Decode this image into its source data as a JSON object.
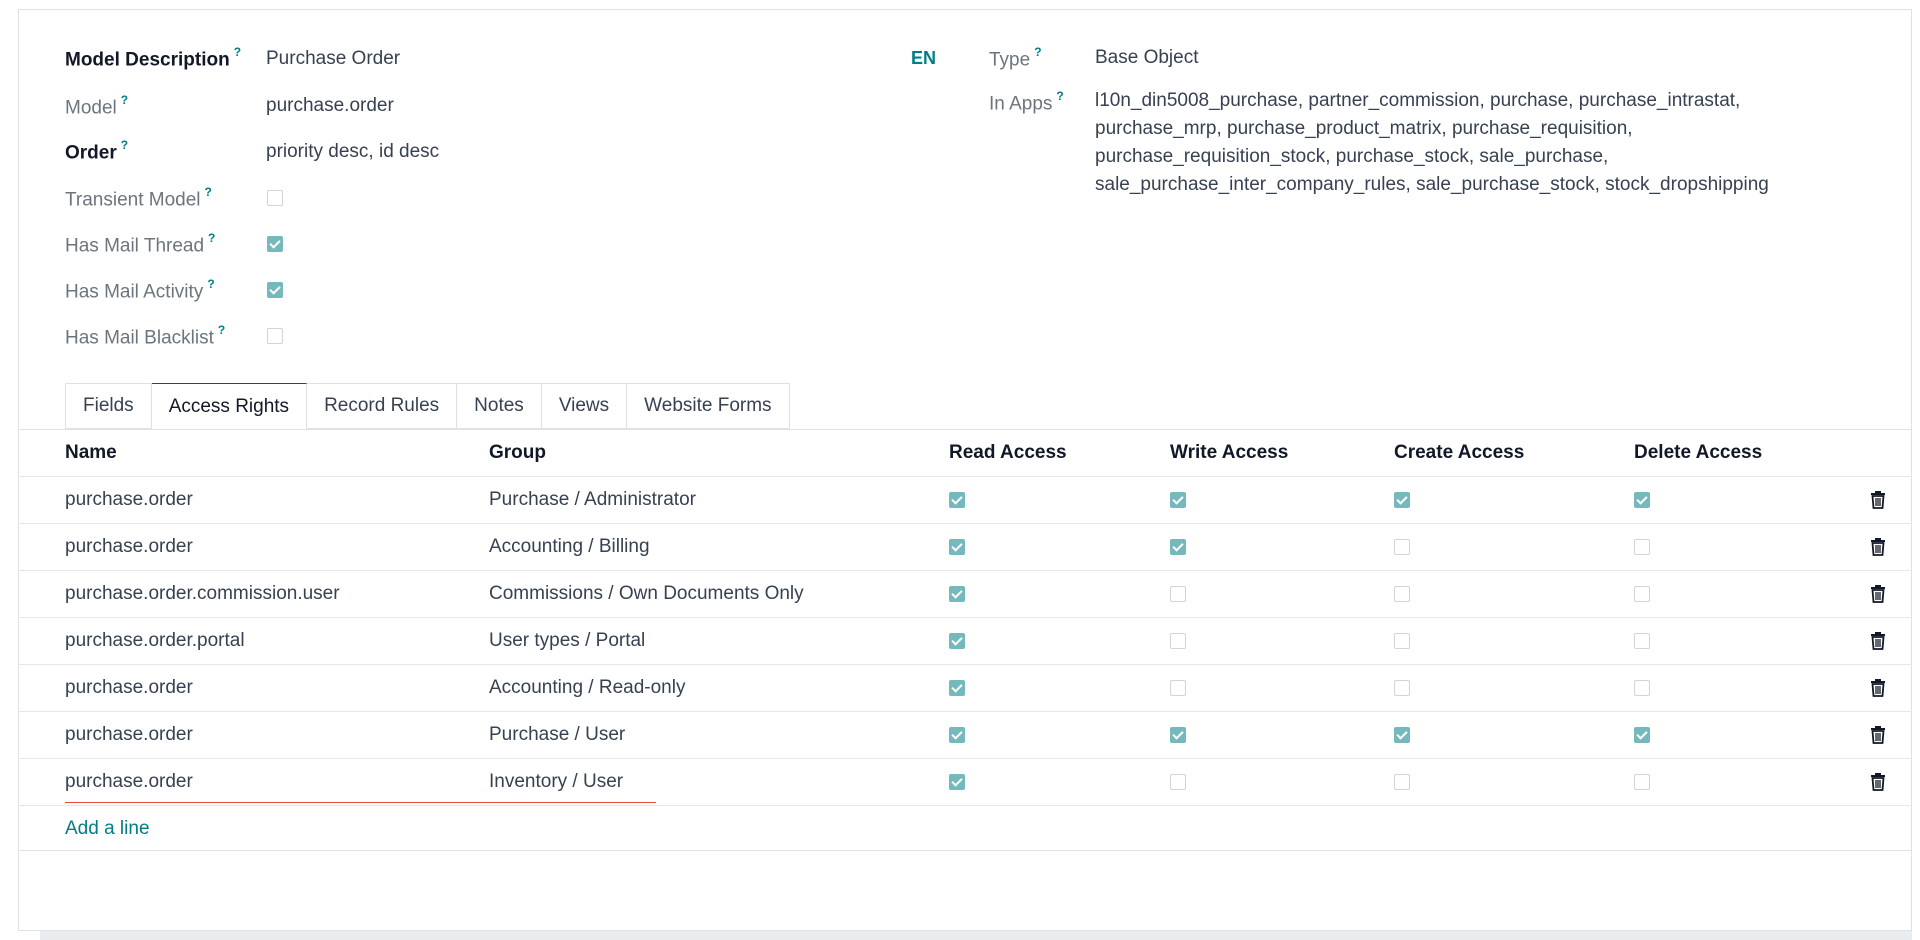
{
  "form": {
    "model_description": {
      "label": "Model Description",
      "help": "?",
      "value": "Purchase Order"
    },
    "model": {
      "label": "Model",
      "help": "?",
      "value": "purchase.order"
    },
    "order": {
      "label": "Order",
      "help": "?",
      "value": "priority desc, id desc"
    },
    "transient_model": {
      "label": "Transient Model",
      "help": "?",
      "checked": false
    },
    "has_mail_thread": {
      "label": "Has Mail Thread",
      "help": "?",
      "checked": true
    },
    "has_mail_activity": {
      "label": "Has Mail Activity",
      "help": "?",
      "checked": true
    },
    "has_mail_blacklist": {
      "label": "Has Mail Blacklist",
      "help": "?",
      "checked": false
    },
    "lang": "EN",
    "type": {
      "label": "Type",
      "help": "?",
      "value": "Base Object"
    },
    "in_apps": {
      "label": "In Apps",
      "help": "?",
      "value": "l10n_din5008_purchase, partner_commission, purchase, purchase_intrastat, purchase_mrp, purchase_product_matrix, purchase_requisition, purchase_requisition_stock, purchase_stock, sale_purchase, sale_purchase_inter_company_rules, sale_purchase_stock, stock_dropshipping"
    }
  },
  "tabs": [
    {
      "label": "Fields",
      "active": false
    },
    {
      "label": "Access Rights",
      "active": true
    },
    {
      "label": "Record Rules",
      "active": false
    },
    {
      "label": "Notes",
      "active": false
    },
    {
      "label": "Views",
      "active": false
    },
    {
      "label": "Website Forms",
      "active": false
    }
  ],
  "table": {
    "columns": {
      "name": "Name",
      "group": "Group",
      "read": "Read Access",
      "write": "Write Access",
      "create": "Create Access",
      "delete": "Delete Access"
    },
    "rows": [
      {
        "name": "purchase.order",
        "group": "Purchase / Administrator",
        "read": true,
        "write": true,
        "create": true,
        "delete": true
      },
      {
        "name": "purchase.order",
        "group": "Accounting / Billing",
        "read": true,
        "write": true,
        "create": false,
        "delete": false
      },
      {
        "name": "purchase.order.commission.user",
        "group": "Commissions / Own Documents Only",
        "read": true,
        "write": false,
        "create": false,
        "delete": false
      },
      {
        "name": "purchase.order.portal",
        "group": "User types / Portal",
        "read": true,
        "write": false,
        "create": false,
        "delete": false
      },
      {
        "name": "purchase.order",
        "group": "Accounting / Read-only",
        "read": true,
        "write": false,
        "create": false,
        "delete": false
      },
      {
        "name": "purchase.order",
        "group": "Purchase / User",
        "read": true,
        "write": true,
        "create": true,
        "delete": true
      },
      {
        "name": "purchase.order",
        "group": "Inventory / User",
        "read": true,
        "write": false,
        "create": false,
        "delete": false,
        "invalid": true
      }
    ],
    "add_line_label": "Add a line",
    "row_action_icon": "trash-icon"
  },
  "colors": {
    "accent": "#017e84",
    "checkbox_checked": "#75b9bd",
    "invalid_underline": "#e74c3c"
  }
}
